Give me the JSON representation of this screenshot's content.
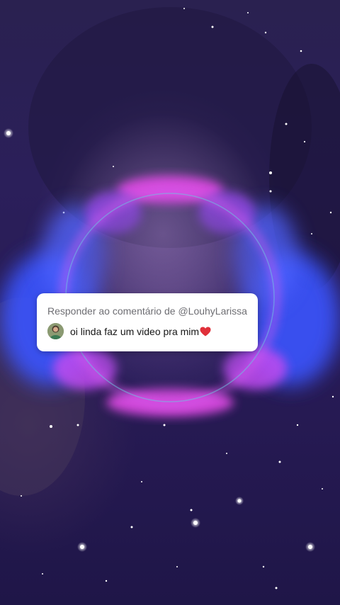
{
  "reply_card": {
    "header": "Responder ao comentário de @LouhyLarissa",
    "comment": "oi linda faz um video pra mim",
    "comment_emoji": "heart-icon",
    "avatar_icon": "avatar"
  },
  "colors": {
    "background": "#2b1f5a",
    "visualizer_blue": "#3a55ff",
    "visualizer_pink": "#e24be6",
    "heart": "#e0303a",
    "card": "#ffffff",
    "header_text": "#6e6e73",
    "comment_text": "#161616"
  }
}
